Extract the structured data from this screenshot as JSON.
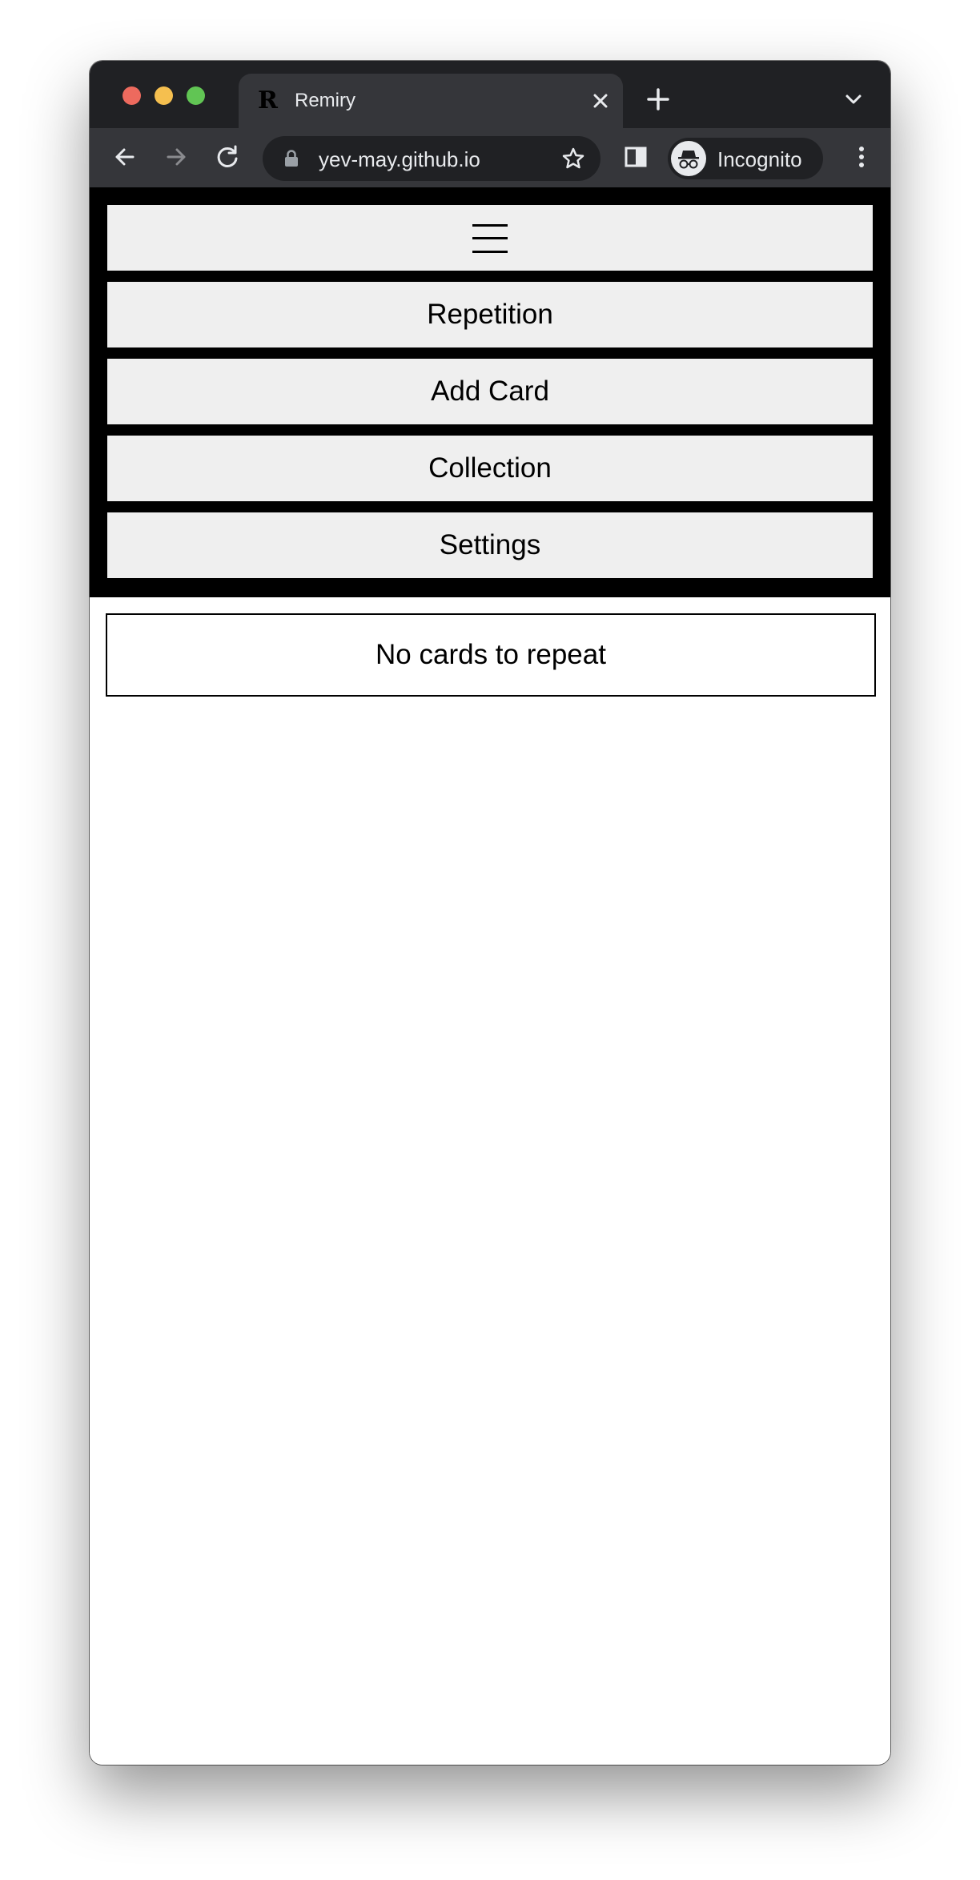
{
  "browser": {
    "tab_title": "Remiry",
    "tab_favicon": "R",
    "url": "yev-may.github.io",
    "profile_label": "Incognito",
    "icons": [
      "back-arrow-icon",
      "forward-arrow-icon",
      "reload-icon",
      "lock-icon",
      "star-icon",
      "side-panel-icon",
      "incognito-icon",
      "more-vertical-icon",
      "close-icon",
      "plus-icon",
      "chevron-down-icon"
    ]
  },
  "nav": {
    "menu_icon": "hamburger-menu-icon",
    "items": [
      {
        "label": "Repetition"
      },
      {
        "label": "Add Card"
      },
      {
        "label": "Collection"
      },
      {
        "label": "Settings"
      }
    ]
  },
  "main": {
    "status": "No cards to repeat"
  }
}
